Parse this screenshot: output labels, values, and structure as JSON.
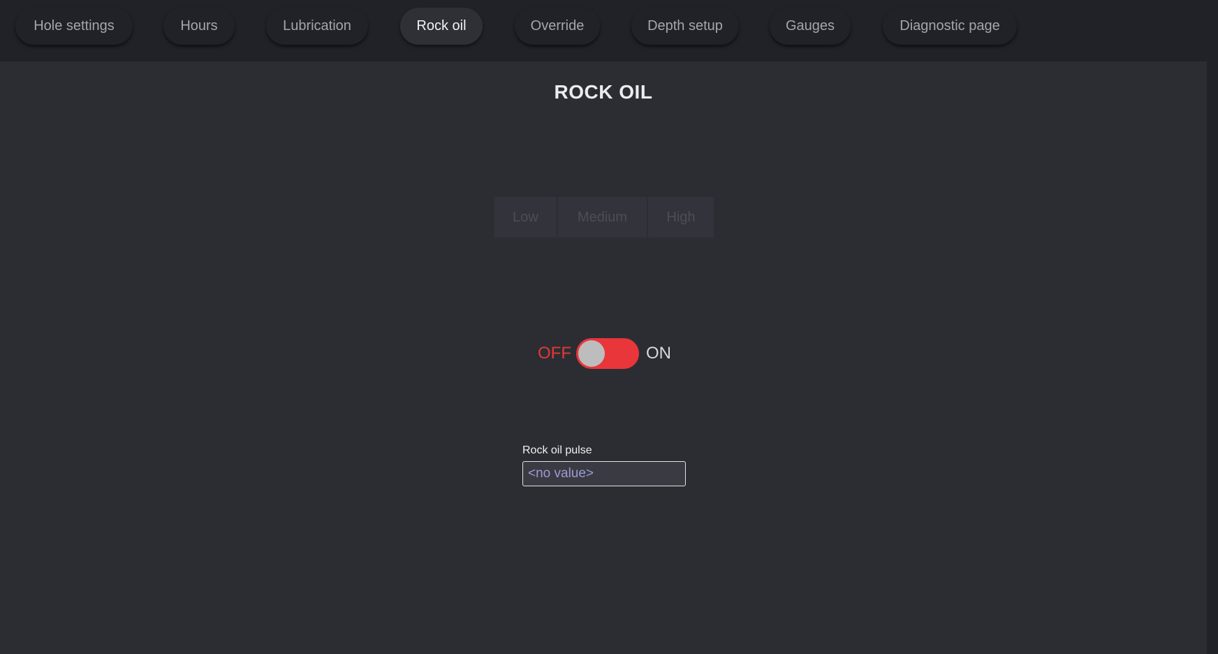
{
  "tabs": [
    {
      "label": "Hole settings",
      "active": false
    },
    {
      "label": "Hours",
      "active": false
    },
    {
      "label": "Lubrication",
      "active": false
    },
    {
      "label": "Rock oil",
      "active": true
    },
    {
      "label": "Override",
      "active": false
    },
    {
      "label": "Depth setup",
      "active": false
    },
    {
      "label": "Gauges",
      "active": false
    },
    {
      "label": "Diagnostic page",
      "active": false
    }
  ],
  "page": {
    "title": "ROCK OIL"
  },
  "level_selector": {
    "options": [
      "Low",
      "Medium",
      "High"
    ],
    "disabled": true
  },
  "toggle": {
    "off_label": "OFF",
    "on_label": "ON",
    "state": "off",
    "color": "#e8363b"
  },
  "pulse_field": {
    "label": "Rock oil pulse",
    "placeholder": "<no value>",
    "value": ""
  }
}
